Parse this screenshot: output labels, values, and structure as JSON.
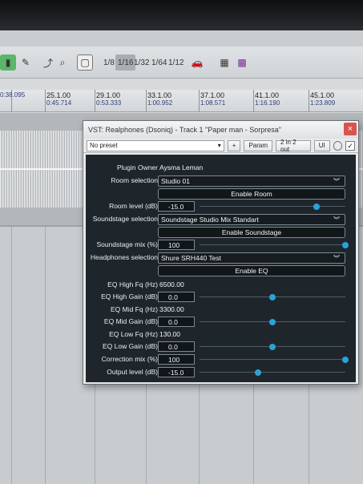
{
  "toolbar": {
    "grid_options": [
      "1/8",
      "1/16",
      "1/32",
      "1/64",
      "1/12"
    ],
    "grid_selected": "1/16"
  },
  "ruler": {
    "marks": [
      {
        "bar": "",
        "time": "0:38.095"
      },
      {
        "bar": "25.1.00",
        "time": "0:45.714"
      },
      {
        "bar": "29.1.00",
        "time": "0:53.333"
      },
      {
        "bar": "33.1.00",
        "time": "1:00.952"
      },
      {
        "bar": "37.1.00",
        "time": "1:08.571"
      },
      {
        "bar": "41.1.00",
        "time": "1:16.190"
      },
      {
        "bar": "45.1.00",
        "time": "1:23.809"
      }
    ]
  },
  "plugin": {
    "title": "VST: Realphones (Dsoniq) - Track 1 \"Paper man - Sorpresa\"",
    "close_label": "×",
    "preset": "No preset",
    "plus_label": "+",
    "param_label": "Param",
    "io_label": "2 in 2 out",
    "ui_label": "UI",
    "owner_label": "Plugin Owner",
    "owner_value": "Aysma Leman",
    "room_selection_label": "Room selection",
    "room_selection_value": "Studio 01",
    "enable_room_label": "Enable Room",
    "room_level_label": "Room level (dB)",
    "room_level_value": "-15.0",
    "room_level_fraction": 0.8,
    "soundstage_selection_label": "Soundstage selection",
    "soundstage_selection_value": "Soundstage Studio Mix Standart",
    "enable_soundstage_label": "Enable Soundstage",
    "soundstage_mix_label": "Soundstage mix (%)",
    "soundstage_mix_value": "100",
    "soundstage_mix_fraction": 1.0,
    "headphones_selection_label": "Headphones selection",
    "headphones_selection_value": "Shure SRH440 Test",
    "enable_eq_label": "Enable EQ",
    "eq_high_fq_label": "EQ High Fq (Hz)",
    "eq_high_fq_value": "6500.00",
    "eq_high_gain_label": "EQ High Gain (dB)",
    "eq_high_gain_value": "0.0",
    "eq_high_gain_fraction": 0.5,
    "eq_mid_fq_label": "EQ Mid Fq (Hz)",
    "eq_mid_fq_value": "3300.00",
    "eq_mid_gain_label": "EQ Mid Gain (dB)",
    "eq_mid_gain_value": "0.0",
    "eq_mid_gain_fraction": 0.5,
    "eq_low_fq_label": "EQ Low Fq (Hz)",
    "eq_low_fq_value": "130.00",
    "eq_low_gain_label": "EQ Low Gain (dB)",
    "eq_low_gain_value": "0.0",
    "eq_low_gain_fraction": 0.5,
    "correction_mix_label": "Correction mix (%)",
    "correction_mix_value": "100",
    "correction_mix_fraction": 1.0,
    "output_level_label": "Output level (dB)",
    "output_level_value": "-15.0",
    "output_level_fraction": 0.4,
    "accent_color": "#2aa2d9"
  }
}
